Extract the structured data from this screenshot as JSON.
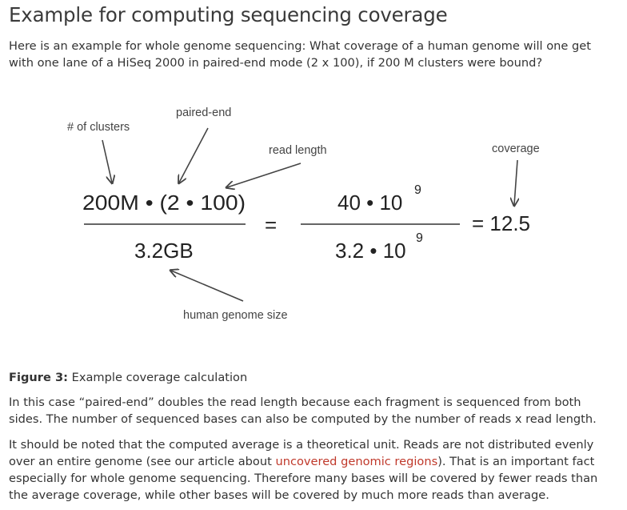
{
  "page": {
    "title": "Example for computing sequencing coverage",
    "intro": "Here is an example for whole genome sequencing: What coverage of a human genome will one get with one lane of a HiSeq 2000 in paired-end mode (2 x 100), if 200 M clusters were bound?"
  },
  "figure": {
    "labels": {
      "clusters": "# of clusters",
      "paired_end": "paired-end",
      "read_length": "read length",
      "coverage": "coverage",
      "genome_size": "human genome size"
    },
    "formula": {
      "numerator_left": "200M • (2 • 100)",
      "denominator_left": "3.2GB",
      "equals": "=",
      "numerator_right": "40 • 10",
      "numerator_right_exp": "9",
      "denominator_right": "3.2 • 10",
      "denominator_right_exp": "9",
      "result": "= 12.5"
    }
  },
  "caption": {
    "label": "Figure 3:",
    "text": " Example coverage calculation"
  },
  "body": {
    "para1": "In this case “paired-end” doubles the read length because each fragment is sequenced from both sides. The number of sequenced bases can also be computed by the number of reads x read length.",
    "para2_before": "It should be noted that the computed average is a theoretical unit. Reads are not distributed evenly over an entire genome (see our article about ",
    "para2_link": "uncovered genomic regions",
    "para2_after": "). That is an important fact especially for whole genome sequencing. Therefore many bases will be covered by fewer reads than the average coverage, while other bases will be covered by much more reads than average."
  }
}
